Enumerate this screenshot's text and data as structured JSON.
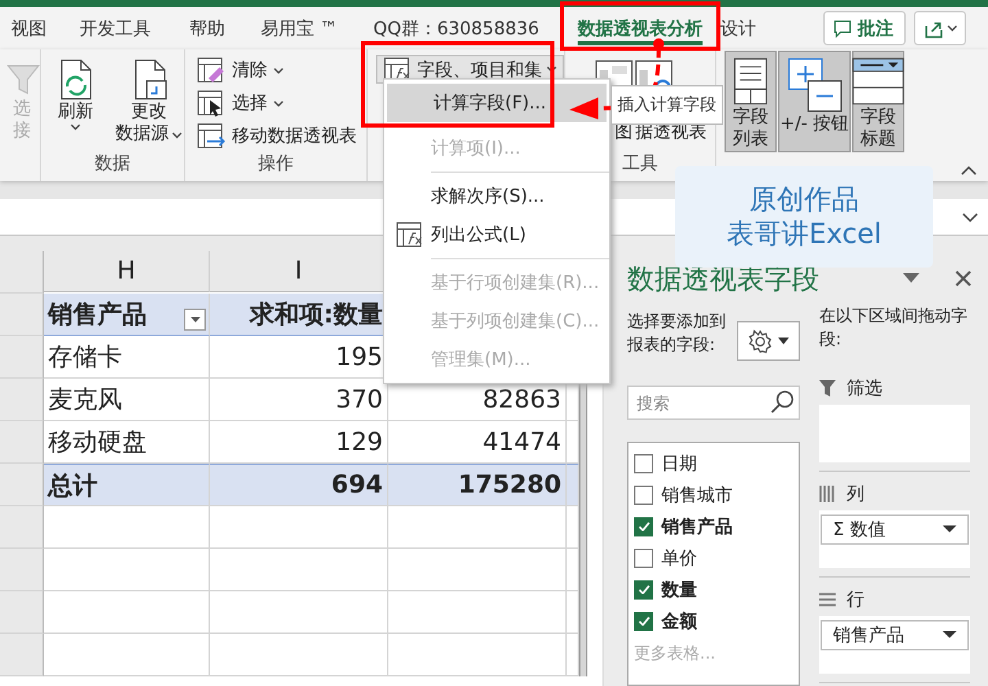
{
  "tabs": [
    {
      "label": "视图",
      "selected": false
    },
    {
      "label": "开发工具",
      "selected": false
    },
    {
      "label": "帮助",
      "selected": false
    },
    {
      "label": "易用宝 ™",
      "selected": false
    },
    {
      "label": "QQ群：630858836",
      "selected": false
    },
    {
      "label": "数据透视表分析",
      "selected": true
    },
    {
      "label": "设计",
      "selected": false
    }
  ],
  "comment_button": {
    "label": "批注"
  },
  "ribbon_groups": [
    {
      "kind": "partial",
      "buttons": [
        {
          "kind": "filter",
          "lines": [
            "选",
            "接"
          ],
          "disabled": true
        }
      ]
    },
    {
      "kind": "large",
      "title": "数据",
      "buttons": [
        {
          "kind": "refresh",
          "lines": [
            "刷新"
          ],
          "dropdown": true
        },
        {
          "kind": "source",
          "lines": [
            "更改",
            "数据源"
          ],
          "dropdown": true
        }
      ]
    },
    {
      "kind": "small",
      "title": "操作",
      "buttons": [
        {
          "kind": "clear",
          "label": "清除",
          "dropdown": true
        },
        {
          "kind": "select",
          "label": "选择",
          "dropdown": true
        },
        {
          "kind": "move",
          "label": "移动数据透视表",
          "dropdown": false
        }
      ]
    },
    {
      "kind": "menu",
      "buttons": [
        {
          "kind": "formula",
          "label": "字段、项目和集",
          "dropdown": true
        }
      ]
    },
    {
      "kind": "tools",
      "title": "工具",
      "buttons": [
        {
          "kind": "chart",
          "lines": [
            "图"
          ]
        },
        {
          "kind": "recommend",
          "lines": [
            "据透视表"
          ]
        }
      ]
    },
    {
      "kind": "toggles",
      "buttons": [
        {
          "kind": "list",
          "lines": [
            "字段",
            "列表"
          ],
          "on": true
        },
        {
          "kind": "plusminus",
          "lines": [
            "+/- 按钮"
          ],
          "on": true
        },
        {
          "kind": "headers",
          "lines": [
            "字段",
            "标题"
          ],
          "on": true
        }
      ]
    }
  ],
  "dropdown_menu": {
    "items": [
      {
        "kind": "item",
        "label": "计算字段(F)...",
        "selected": true,
        "disabled": false
      },
      {
        "kind": "item",
        "label": "计算项(I)...",
        "selected": false,
        "disabled": true
      },
      {
        "kind": "separator"
      },
      {
        "kind": "item",
        "label": "求解次序(S)...",
        "selected": false,
        "disabled": false
      },
      {
        "kind": "item",
        "label": "列出公式(L)",
        "selected": false,
        "disabled": false
      },
      {
        "kind": "separator"
      },
      {
        "kind": "item",
        "label": "基于行项创建集(R)...",
        "selected": false,
        "disabled": true
      },
      {
        "kind": "item",
        "label": "基于列项创建集(C)...",
        "selected": false,
        "disabled": true
      },
      {
        "kind": "item",
        "label": "管理集(M)...",
        "selected": false,
        "disabled": true
      }
    ]
  },
  "tooltip": {
    "text": "插入计算字段"
  },
  "watermark_card": {
    "lines": [
      "原创作品",
      "表哥讲Excel"
    ]
  },
  "sheet": {
    "columns": [
      "H",
      "I"
    ],
    "header": [
      "销售产品",
      "求和项:数量"
    ],
    "rows": [
      [
        "存储卡",
        "195"
      ],
      [
        "麦克风",
        "370",
        "82863"
      ],
      [
        "移动硬盘",
        "129",
        "41474"
      ]
    ],
    "total": [
      "总计",
      "694",
      "175280"
    ]
  },
  "field_pane": {
    "title": "数据透视表字段",
    "choose_label": "选择要添加到报表的字段:",
    "search": {
      "placeholder": "搜索"
    },
    "fields": [
      {
        "label": "日期",
        "checked": false
      },
      {
        "label": "销售城市",
        "checked": false
      },
      {
        "label": "销售产品",
        "checked": true
      },
      {
        "label": "单价",
        "checked": false
      },
      {
        "label": "数量",
        "checked": true
      },
      {
        "label": "金额",
        "checked": true
      }
    ],
    "more_tables": "更多表格...",
    "drag_label": "在以下区域间拖动字段:",
    "areas": [
      {
        "kind": "filter",
        "title": "筛选"
      },
      {
        "kind": "columns",
        "title": "列",
        "items": [
          {
            "label": "Σ  数值"
          }
        ]
      },
      {
        "kind": "rows",
        "title": "行",
        "items": [
          {
            "label": "销售产品"
          }
        ]
      }
    ]
  }
}
